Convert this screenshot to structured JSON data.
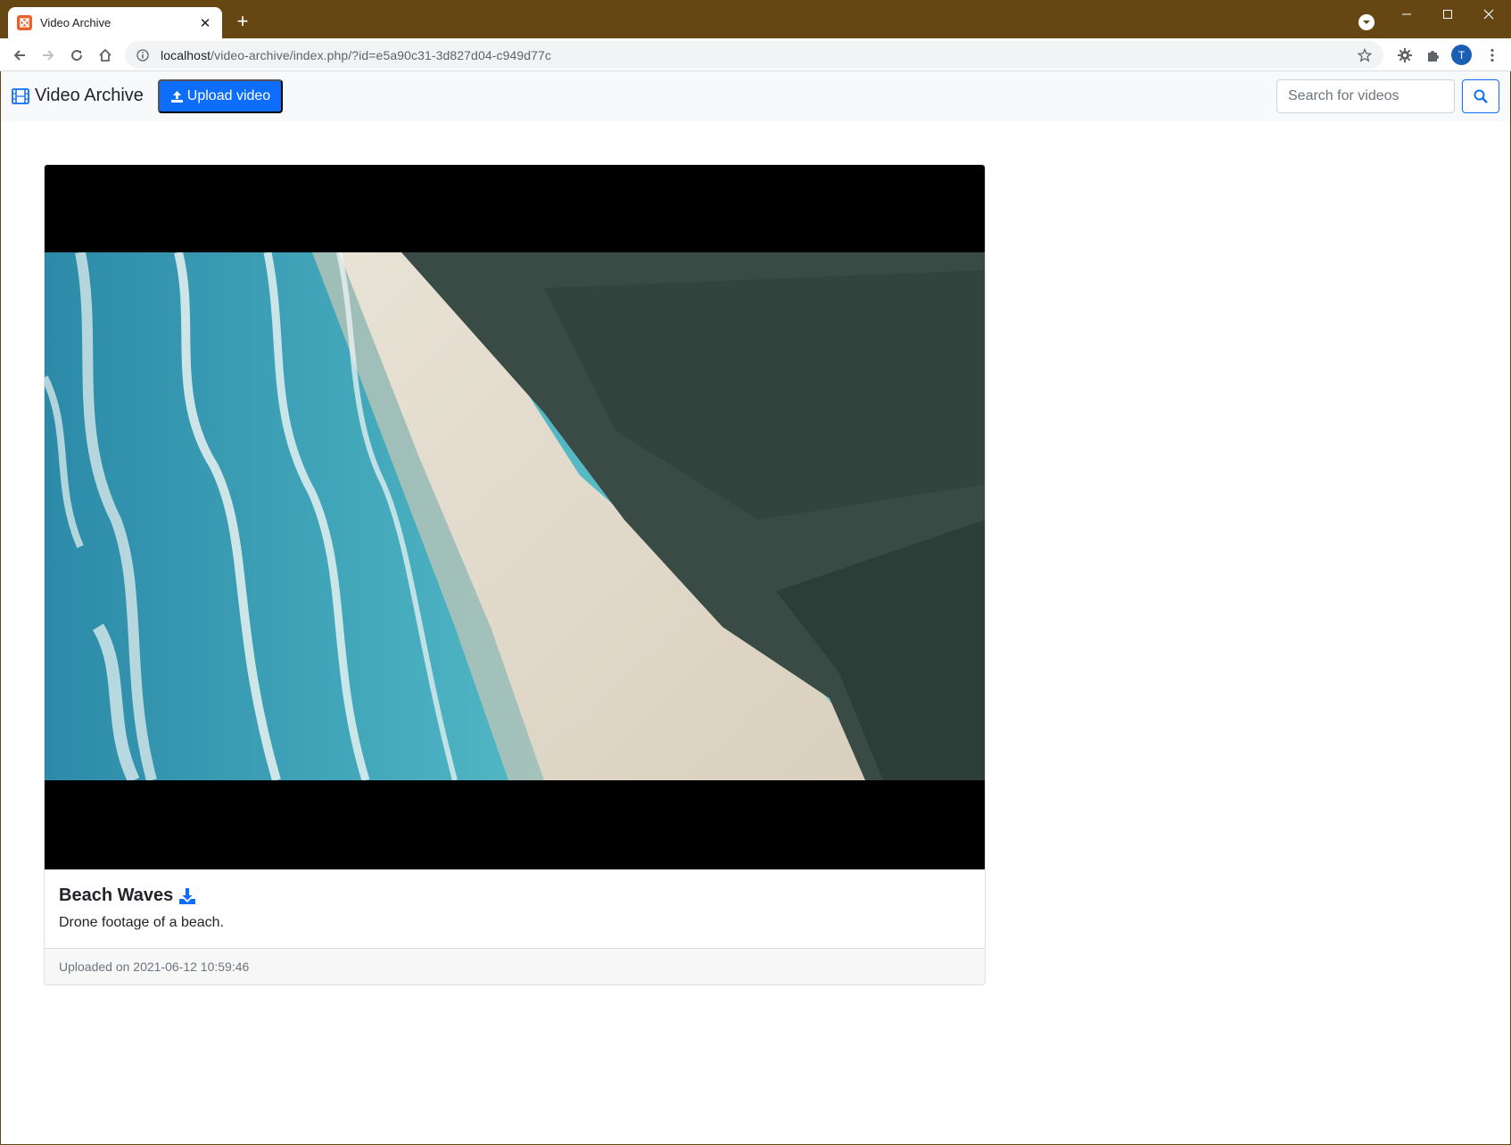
{
  "browser": {
    "tab_title": "Video Archive",
    "url_host": "localhost",
    "url_path": "/video-archive/index.php/?id=e5a90c31-3d827d04-c949d77c",
    "profile_initial": "T",
    "frame_color": "#664714"
  },
  "navbar": {
    "brand_label": "Video Archive",
    "upload_label": "Upload video",
    "search_placeholder": "Search for videos",
    "accent_color": "#0d6efd"
  },
  "video": {
    "title": "Beach Waves",
    "description": "Drone footage of a beach.",
    "uploaded": "Uploaded on 2021-06-12 10:59:46"
  }
}
